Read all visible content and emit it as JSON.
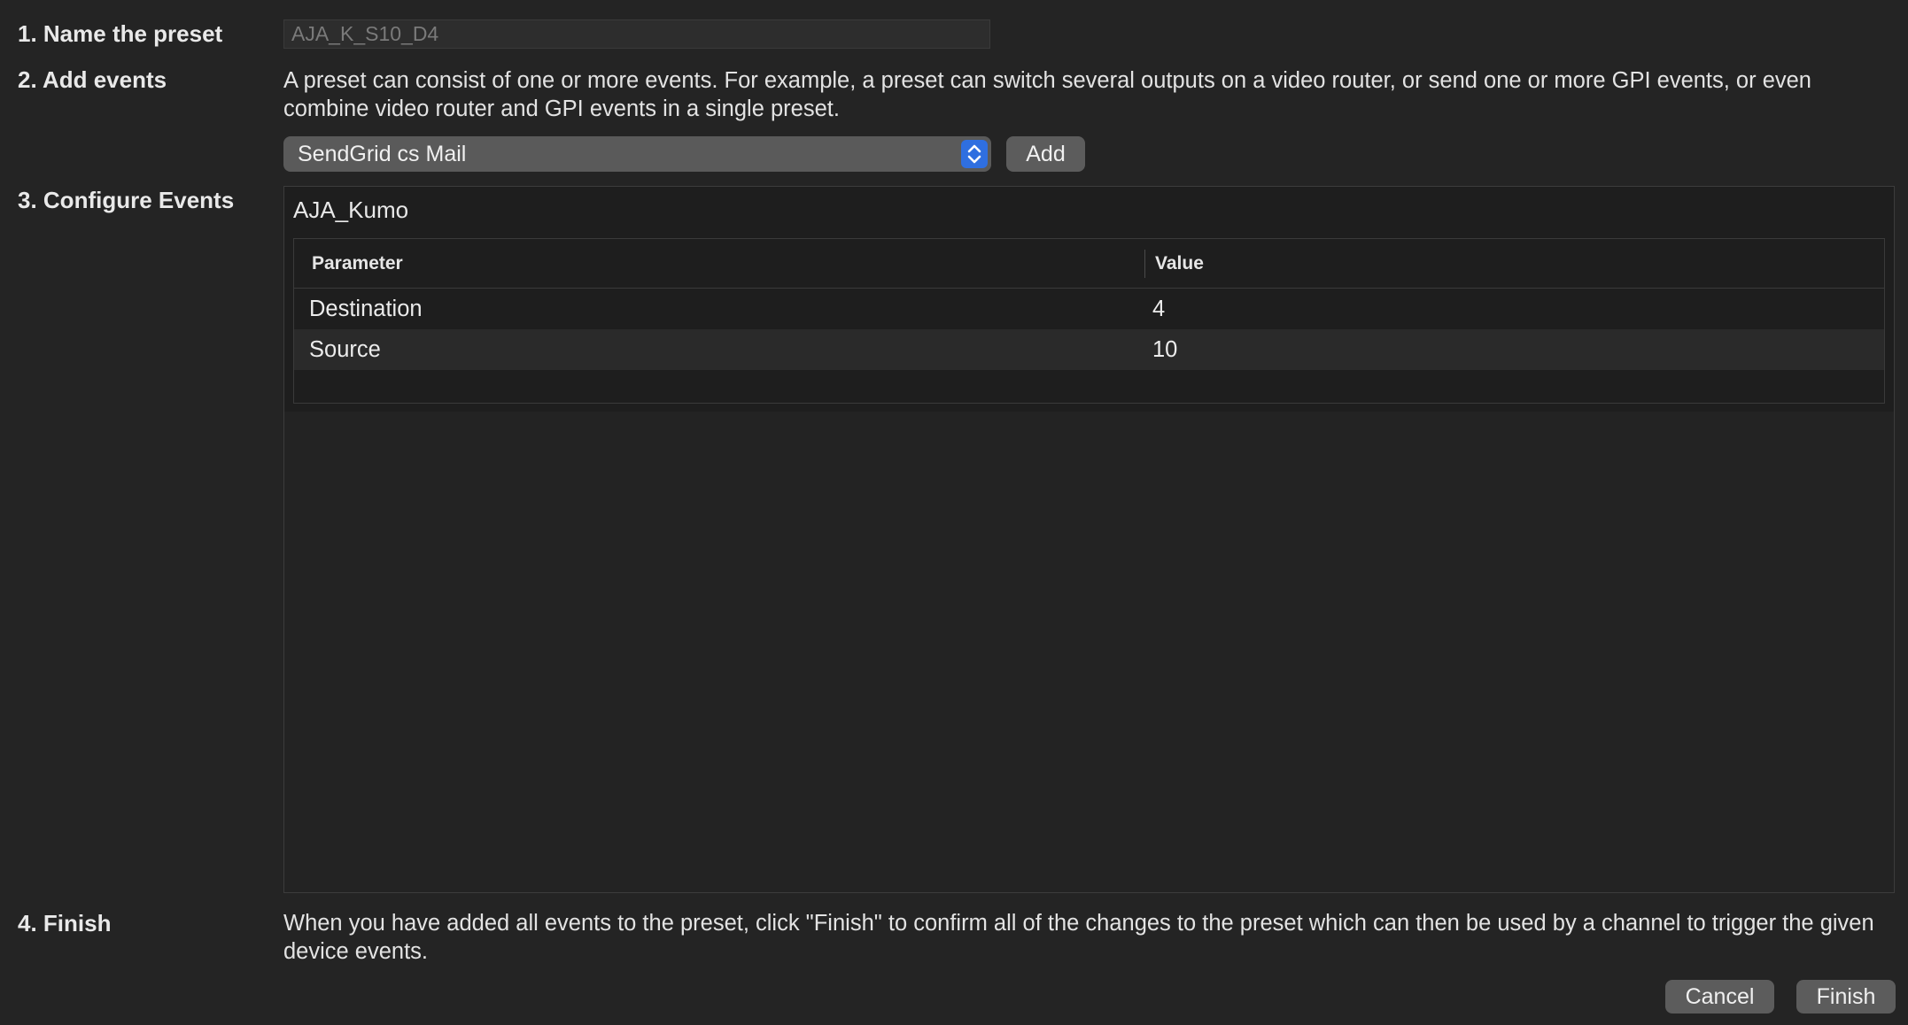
{
  "steps": {
    "name": {
      "label": "1. Name the preset",
      "value": "AJA_K_S10_D4"
    },
    "add_events": {
      "label": "2. Add events",
      "description": "A preset can consist of one or more events. For example, a preset can switch several outputs on a video router, or send one or more GPI events, or even combine video router and GPI events in a single preset.",
      "selected_device": "SendGrid cs Mail",
      "add_button": "Add"
    },
    "configure": {
      "label": "3. Configure Events",
      "event_name": "AJA_Kumo",
      "columns": [
        "Parameter",
        "Value"
      ],
      "rows": [
        {
          "parameter": "Destination",
          "value": "4"
        },
        {
          "parameter": "Source",
          "value": "10"
        }
      ]
    },
    "finish": {
      "label": "4. Finish",
      "description": "When you have added all events to the preset, click \"Finish\" to confirm all of the changes to the preset which can then be used by a channel to trigger the given device events.",
      "cancel_button": "Cancel",
      "finish_button": "Finish"
    }
  },
  "colors": {
    "background": "#242424",
    "accent": "#2f6fe0",
    "button": "#5c5c5c"
  }
}
